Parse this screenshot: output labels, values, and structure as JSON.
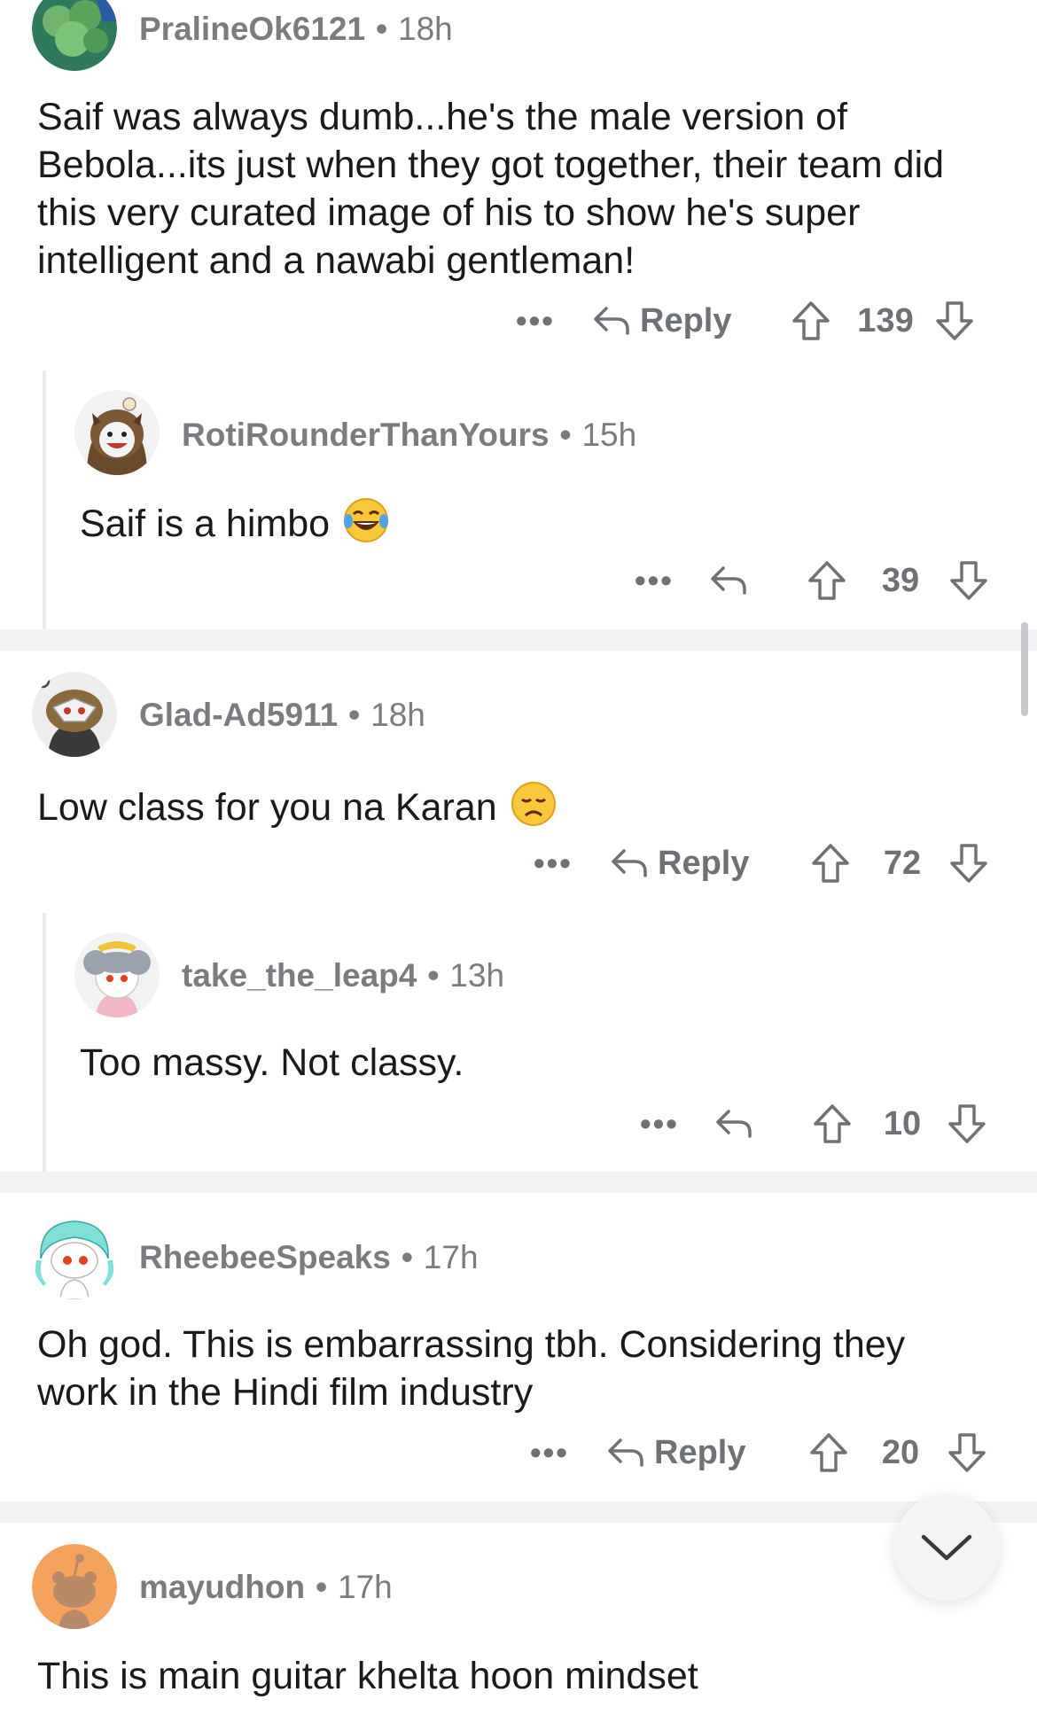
{
  "comments": [
    {
      "username": "PralineOk6121",
      "age": "18h",
      "body": "Saif was always dumb...he's the male version of Bebola...its just when they got together, their team did this very curated image of his to show he's super intelligent and a nawabi gentleman!",
      "reply_label": "Reply",
      "score": "139",
      "avatar_icon": "green-snoo-avatar-icon"
    },
    {
      "username": "RotiRounderThanYours",
      "age": "15h",
      "body": "Saif is a himbo",
      "emoji": "tears-of-joy-emoji",
      "reply_label": "",
      "score": "39",
      "avatar_icon": "owl-snoo-avatar-icon"
    },
    {
      "username": "Glad-Ad5911",
      "age": "18h",
      "body": "Low class for you na Karan",
      "emoji": "disappointed-face-emoji",
      "reply_label": "Reply",
      "score": "72",
      "avatar_icon": "masked-snoo-avatar-icon"
    },
    {
      "username": "take_the_leap4",
      "age": "13h",
      "body": "Too massy. Not classy.",
      "reply_label": "",
      "score": "10",
      "avatar_icon": "koala-snoo-avatar-icon"
    },
    {
      "username": "RheebeeSpeaks",
      "age": "17h",
      "body": "Oh god. This is embarrassing tbh. Considering they work in the Hindi film industry",
      "reply_label": "Reply",
      "score": "20",
      "avatar_icon": "teal-hair-snoo-avatar-icon"
    },
    {
      "username": "mayudhon",
      "age": "17h",
      "body": "This is main guitar khelta hoon mindset",
      "avatar_icon": "orange-snoo-avatar-icon"
    }
  ],
  "separator": "•",
  "more_label": "•••",
  "colors": {
    "meta": "#7c7c80",
    "text": "#1a1a1b",
    "action": "#6e7176",
    "divider": "#f1f2f3",
    "thread_line": "#e9eaeb"
  }
}
